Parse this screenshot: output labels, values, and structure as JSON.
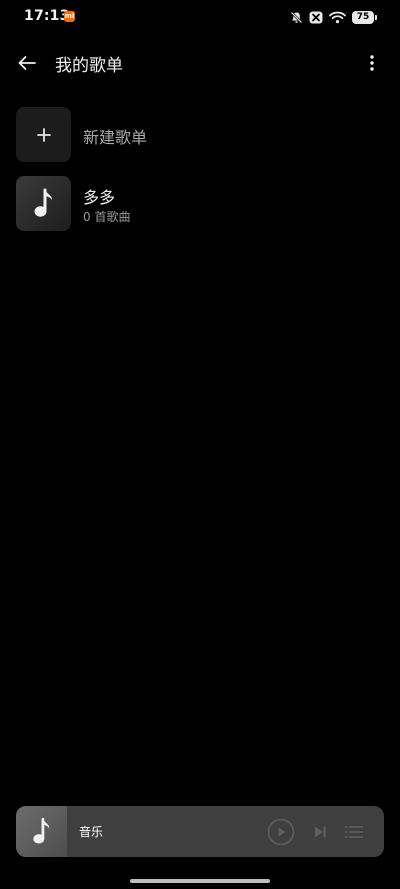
{
  "status_bar": {
    "time": "17:13",
    "battery": "75",
    "notification_app": "mi-icon",
    "icons": [
      "bell-muted-icon",
      "x-badge-icon",
      "wifi-icon",
      "battery-icon"
    ]
  },
  "header": {
    "title": "我的歌单",
    "back_icon": "arrow-left-icon",
    "more_icon": "more-vertical-icon"
  },
  "playlists": {
    "create_label": "新建歌单",
    "create_icon": "plus-icon",
    "items": [
      {
        "name": "多多",
        "subtitle": "0 首歌曲",
        "icon": "music-note-icon"
      }
    ]
  },
  "mini_player": {
    "title": "音乐",
    "cover_icon": "music-note-icon",
    "controls": [
      "play-icon",
      "skip-next-icon",
      "playlist-icon"
    ]
  },
  "colors": {
    "background": "#000000",
    "mini_player_bg": "#3f3f3f",
    "mi_badge": "#ff6a00"
  }
}
